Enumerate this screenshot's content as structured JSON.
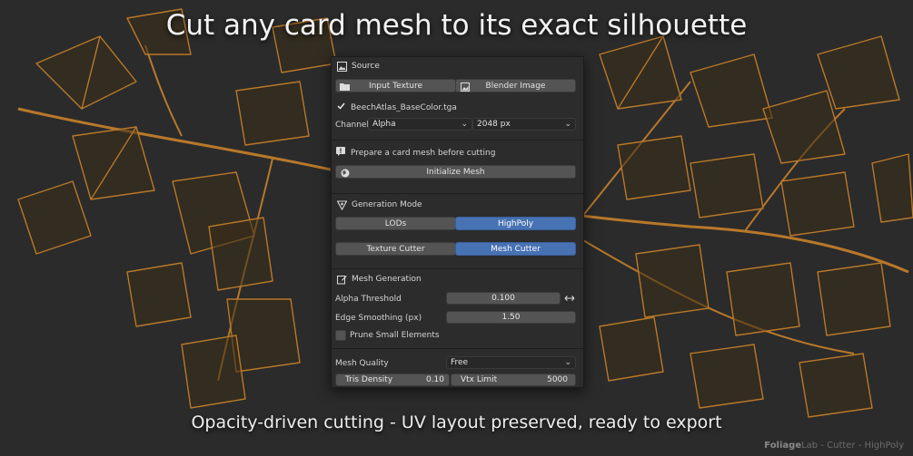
{
  "headline": "Cut any card mesh to its exact silhouette",
  "subline": "Opacity-driven cutting - UV layout preserved, ready to export",
  "watermark": {
    "brand": "Foliage",
    "rest": "Lab - Cutter - HighPoly"
  },
  "colors": {
    "accent": "#4772b3",
    "panel": "#2c2c2c",
    "button": "#545454",
    "foliage_wire": "#c8862a"
  },
  "panel": {
    "source": {
      "header": "Source",
      "icon": "image-icon",
      "input_texture": "Input Texture",
      "blender_image": "Blender Image",
      "file_name": "BeechAtlas_BaseColor.tga",
      "channel_label": "Channel:",
      "channel_value": "Alpha",
      "resolution_value": "2048 px"
    },
    "prepare": {
      "info": "Prepare a card mesh before cutting",
      "initialize": "Initialize Mesh"
    },
    "generation_mode": {
      "header": "Generation Mode",
      "lods": "LODs",
      "highpoly": "HighPoly",
      "texture_cutter": "Texture Cutter",
      "mesh_cutter": "Mesh Cutter"
    },
    "mesh_generation": {
      "header": "Mesh Generation",
      "alpha_threshold_label": "Alpha Threshold",
      "alpha_threshold_value": "0.100",
      "edge_smoothing_label": "Edge Smoothing (px)",
      "edge_smoothing_value": "1.50",
      "prune_label": "Prune Small Elements",
      "prune_checked": false,
      "mesh_quality_label": "Mesh Quality",
      "mesh_quality_value": "Free",
      "tris_density_label": "Tris Density",
      "tris_density_value": "0.10",
      "vtx_limit_label": "Vtx Limit",
      "vtx_limit_value": "5000"
    }
  }
}
